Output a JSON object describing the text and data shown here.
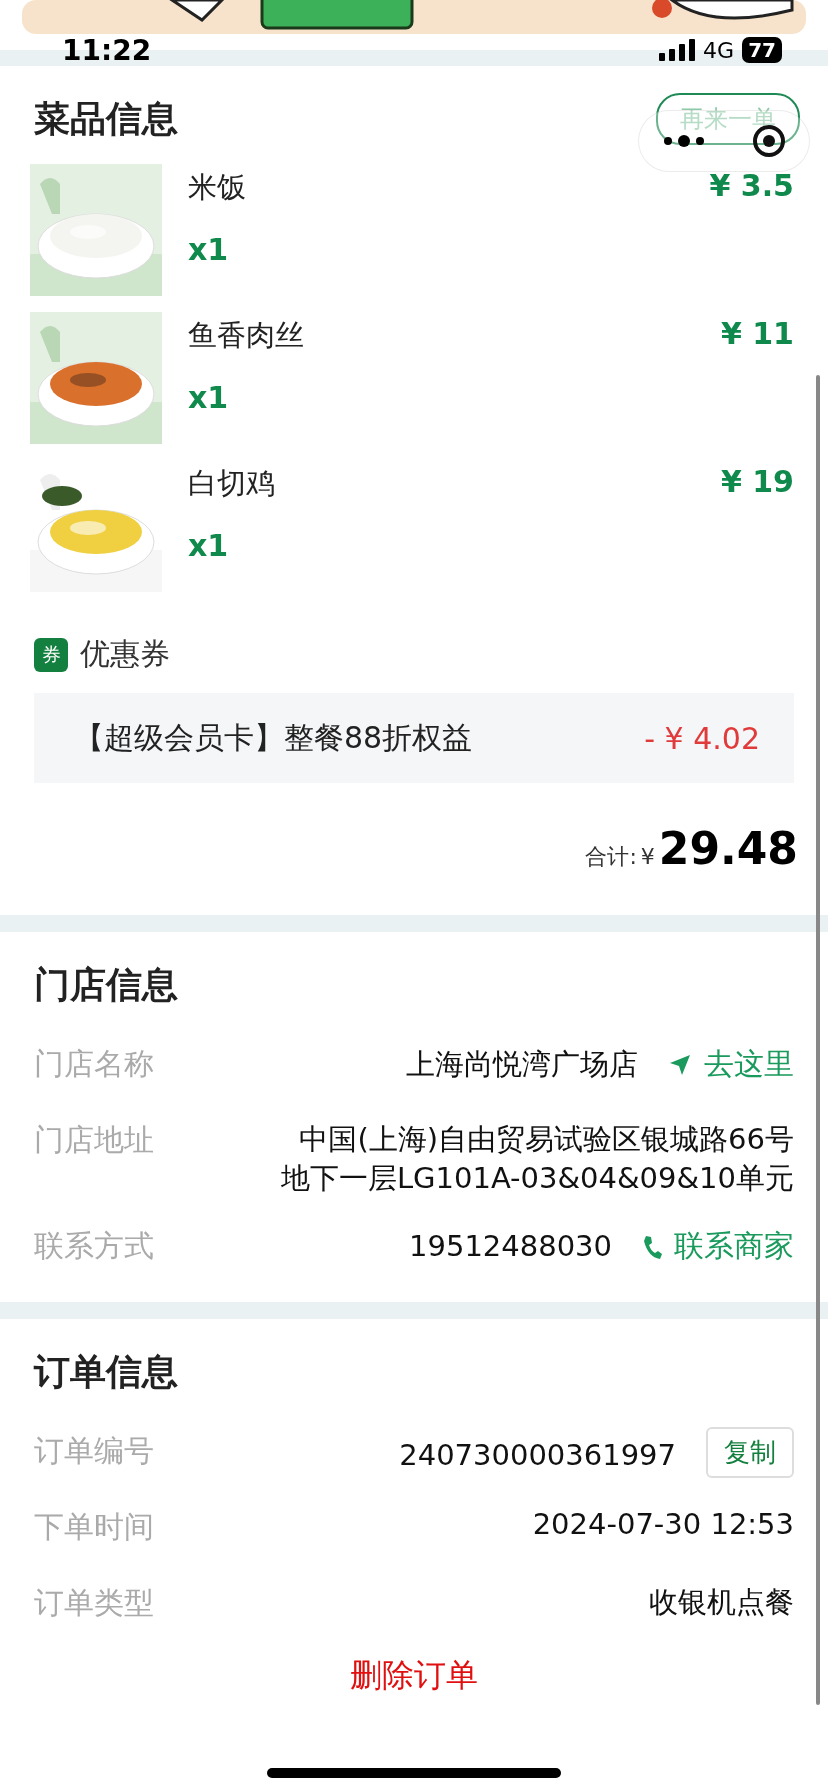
{
  "status_bar": {
    "time": "11:22",
    "network": "4G",
    "battery": "77"
  },
  "dishes": {
    "title": "菜品信息",
    "reorder_button": "再来一单",
    "items": [
      {
        "name": "米饭",
        "quantity": "x1",
        "price": "¥ 3.5"
      },
      {
        "name": "鱼香肉丝",
        "quantity": "x1",
        "price": "¥ 11"
      },
      {
        "name": "白切鸡",
        "quantity": "x1",
        "price": "¥ 19"
      }
    ],
    "coupon": {
      "badge": "券",
      "label": "优惠券",
      "name": "【超级会员卡】整餐88折权益",
      "amount": "- ¥ 4.02"
    },
    "total": {
      "label": "合计:",
      "currency": "¥",
      "amount": "29.48"
    }
  },
  "store": {
    "title": "门店信息",
    "rows": [
      {
        "label": "门店名称",
        "lines": [
          "上海尚悦湾广场店"
        ],
        "action": {
          "kind": "navigate",
          "text": "去这里"
        }
      },
      {
        "label": "门店地址",
        "lines": [
          "中国(上海)自由贸易试验区银城路66号",
          "地下一层LG101A-03&04&09&10单元"
        ]
      },
      {
        "label": "联系方式",
        "lines": [
          "19512488030"
        ],
        "action": {
          "kind": "call",
          "text": "联系商家"
        }
      }
    ]
  },
  "order": {
    "title": "订单信息",
    "rows": [
      {
        "label": "订单编号",
        "value": "240730000361997",
        "button": "复制"
      },
      {
        "label": "下单时间",
        "value": "2024-07-30 12:53"
      },
      {
        "label": "订单类型",
        "value": "收银机点餐"
      }
    ],
    "delete_button": "删除订单"
  }
}
